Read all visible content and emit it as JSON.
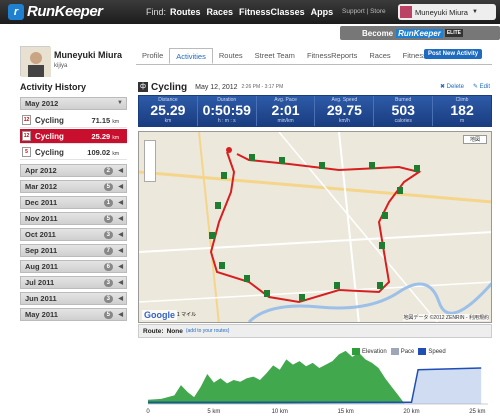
{
  "topbar": {
    "logo_letter": "r",
    "logo": "RunKeeper",
    "find": "Find:",
    "nav": [
      "Routes",
      "Races",
      "FitnessClasses",
      "Apps"
    ],
    "links": "Support | Store",
    "user": "Muneyuki Miura"
  },
  "elite": {
    "become": "Become",
    "rk": "RunKeeper",
    "tag": "ELITE"
  },
  "profile": {
    "name": "Muneyuki Miura",
    "sub": "kijiya"
  },
  "tabs": [
    "Profile",
    "Activities",
    "Routes",
    "Street Team",
    "FitnessReports",
    "Races",
    "FitnessClasses"
  ],
  "post_new": "Post New Activity",
  "history": {
    "title": "Activity History",
    "current_month": "May 2012",
    "activities": [
      {
        "day": "12",
        "label": "Cycling",
        "dist": "71.15",
        "unit": "km"
      },
      {
        "day": "12",
        "label": "Cycling",
        "dist": "25.29",
        "unit": "km"
      },
      {
        "day": "5",
        "label": "Cycling",
        "dist": "109.02",
        "unit": "km"
      }
    ],
    "months": [
      {
        "label": "Apr 2012",
        "count": "2"
      },
      {
        "label": "Mar 2012",
        "count": "5"
      },
      {
        "label": "Dec 2011",
        "count": "1"
      },
      {
        "label": "Nov 2011",
        "count": "5"
      },
      {
        "label": "Oct 2011",
        "count": "3"
      },
      {
        "label": "Sep 2011",
        "count": "7"
      },
      {
        "label": "Aug 2011",
        "count": "6"
      },
      {
        "label": "Jul 2011",
        "count": "3"
      },
      {
        "label": "Jun 2011",
        "count": "3"
      },
      {
        "label": "May 2011",
        "count": "5"
      }
    ]
  },
  "activity": {
    "icon": "ф",
    "title": "Cycling",
    "date": "May 12, 2012",
    "time": "2:26 PM - 3:17 PM",
    "delete": "✖ Delete",
    "edit": "✎ Edit"
  },
  "stats": [
    {
      "label": "Distance",
      "value": "25.29",
      "unit": "km"
    },
    {
      "label": "Duration",
      "value": "0:50:59",
      "unit": "h : m : s"
    },
    {
      "label": "Avg. Pace",
      "value": "2:01",
      "unit": "min/km"
    },
    {
      "label": "Avg. Speed",
      "value": "29.75",
      "unit": "km/h"
    },
    {
      "label": "Burned",
      "value": "503",
      "unit": "calories"
    },
    {
      "label": "Climb",
      "value": "182",
      "unit": "m"
    }
  ],
  "map": {
    "type": "地図",
    "google": "Google",
    "scale": "1 マイル",
    "copyright": "地図データ ©2012 ZENRIN - 利用規約"
  },
  "route": {
    "label": "Route:",
    "value": "None",
    "add": "(add to your routes)"
  },
  "chart_data": {
    "type": "area",
    "x_ticks": [
      "0",
      "5 km",
      "10 km",
      "15 km",
      "20 km",
      "25 km"
    ],
    "legend": [
      "Elevation",
      "Pace",
      "Speed"
    ],
    "colors": {
      "elevation": "#2e9e3a",
      "pace": "#9ea7b8",
      "speed": "#1f4fb5"
    },
    "elevation": [
      [
        0,
        5
      ],
      [
        1,
        6
      ],
      [
        2,
        10
      ],
      [
        2.5,
        22
      ],
      [
        3,
        14
      ],
      [
        3.5,
        8
      ],
      [
        4,
        20
      ],
      [
        4.5,
        35
      ],
      [
        5,
        25
      ],
      [
        5.5,
        30
      ],
      [
        6,
        24
      ],
      [
        6.5,
        28
      ],
      [
        7,
        26
      ],
      [
        7.5,
        30
      ],
      [
        8,
        32
      ],
      [
        8.5,
        28
      ],
      [
        9,
        36
      ],
      [
        9.5,
        45
      ],
      [
        10,
        40
      ],
      [
        10.5,
        52
      ],
      [
        11,
        46
      ],
      [
        11.5,
        50
      ],
      [
        12,
        44
      ],
      [
        12.5,
        48
      ],
      [
        13,
        42
      ],
      [
        13.5,
        46
      ],
      [
        14,
        50
      ],
      [
        14.5,
        58
      ],
      [
        15,
        62
      ],
      [
        15.5,
        55
      ],
      [
        16,
        60
      ],
      [
        16.5,
        52
      ],
      [
        17,
        48
      ],
      [
        17.5,
        42
      ],
      [
        18,
        30
      ],
      [
        18.5,
        20
      ],
      [
        19,
        10
      ],
      [
        19.5,
        0
      ],
      [
        20,
        0
      ]
    ],
    "speed": [
      [
        0,
        2
      ],
      [
        5,
        2
      ],
      [
        10,
        2
      ],
      [
        15,
        2
      ],
      [
        20,
        2
      ],
      [
        20.5,
        40
      ],
      [
        25.29,
        42
      ]
    ]
  }
}
